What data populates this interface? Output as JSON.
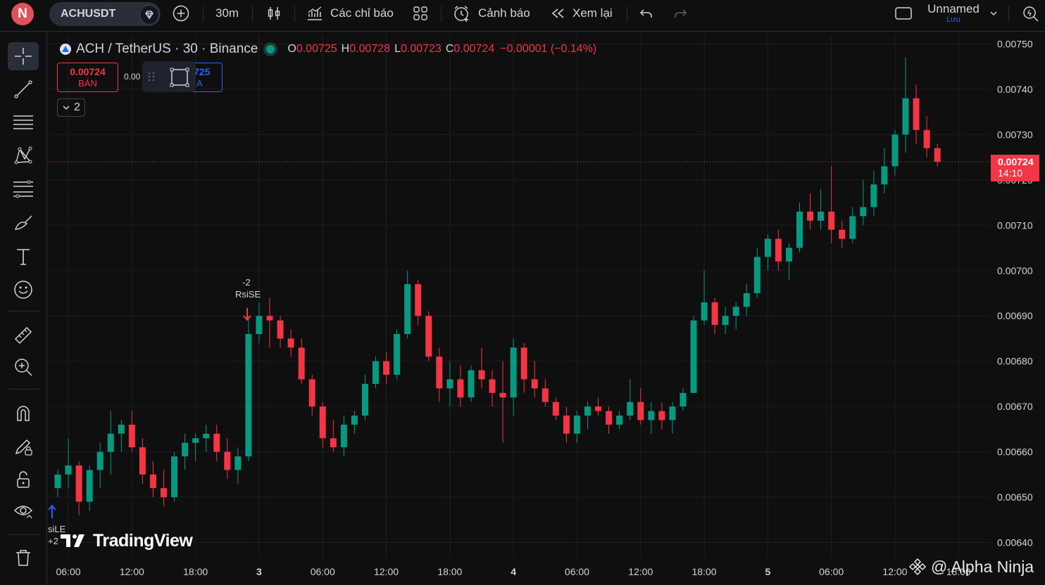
{
  "header": {
    "avatar_letter": "N",
    "symbol": "ACHUSDT",
    "interval": "30m",
    "indicators_label": "Các chỉ báo",
    "alerts_label": "Cảnh báo",
    "replay_label": "Xem lại",
    "layout_name": "Unnamed",
    "save_status": "Lưu"
  },
  "legend": {
    "title": "ACH / TetherUS · 30 · Binance",
    "o_label": "O",
    "o_value": "0.00725",
    "h_label": "H",
    "h_value": "0.00728",
    "l_label": "L",
    "l_value": "0.00723",
    "c_label": "C",
    "c_value": "0.00724",
    "change": "−0.00001 (−0.14%)"
  },
  "trade": {
    "sell_price": "0.00724",
    "sell_label": "BÁN",
    "spread": "0.00",
    "buy_price": "725",
    "buy_label": "A",
    "collapse_count": "2"
  },
  "markers": {
    "sell_count": "-2",
    "sell_name": "RsiSE",
    "buy_name": "siLE",
    "buy_count": "+2"
  },
  "branding": {
    "tradingview": "TradingView",
    "watermark": "@ Alpha Ninja"
  },
  "current_price": {
    "value": "0.00724",
    "countdown": "14:10"
  },
  "colors": {
    "up": "#089981",
    "down": "#f23645",
    "background": "#0f0f0f",
    "grid": "#1c1f26"
  },
  "chart_data": {
    "type": "candlestick",
    "title": "ACH / TetherUS · 30 · Binance",
    "y_ticks": [
      "0.00750",
      "0.00740",
      "0.00730",
      "0.00720",
      "0.00710",
      "0.00700",
      "0.00690",
      "0.00680",
      "0.00670",
      "0.00660",
      "0.00650",
      "0.00640"
    ],
    "ylim": [
      0.00639,
      0.00751
    ],
    "x_ticks": [
      "06:00",
      "12:00",
      "18:00",
      "3",
      "06:00",
      "12:00",
      "18:00",
      "4",
      "06:00",
      "12:00",
      "18:00",
      "5",
      "06:00",
      "12:00",
      "18:00"
    ],
    "x_tick_index": [
      1,
      7,
      13,
      19,
      25,
      31,
      37,
      43,
      49,
      55,
      61,
      67,
      73,
      79,
      85
    ],
    "current_price": 0.00724,
    "ohlc": [
      [
        0.00652,
        0.00656,
        0.0065,
        0.00655
      ],
      [
        0.00655,
        0.00663,
        0.00652,
        0.00657
      ],
      [
        0.00657,
        0.00658,
        0.00646,
        0.00649
      ],
      [
        0.00649,
        0.00657,
        0.00647,
        0.00656
      ],
      [
        0.00656,
        0.00662,
        0.00652,
        0.0066
      ],
      [
        0.0066,
        0.00669,
        0.00655,
        0.00664
      ],
      [
        0.00664,
        0.00667,
        0.0066,
        0.00666
      ],
      [
        0.00666,
        0.00669,
        0.0066,
        0.00661
      ],
      [
        0.00661,
        0.00663,
        0.00653,
        0.00655
      ],
      [
        0.00655,
        0.00658,
        0.0065,
        0.00652
      ],
      [
        0.00652,
        0.00656,
        0.00648,
        0.0065
      ],
      [
        0.0065,
        0.0066,
        0.00649,
        0.00659
      ],
      [
        0.00659,
        0.00664,
        0.00656,
        0.00662
      ],
      [
        0.00662,
        0.00664,
        0.00658,
        0.00663
      ],
      [
        0.00663,
        0.00666,
        0.0066,
        0.00664
      ],
      [
        0.00664,
        0.00666,
        0.00658,
        0.0066
      ],
      [
        0.0066,
        0.00663,
        0.00654,
        0.00656
      ],
      [
        0.00656,
        0.00661,
        0.00653,
        0.00659
      ],
      [
        0.00659,
        0.0069,
        0.00658,
        0.00686
      ],
      [
        0.00686,
        0.00693,
        0.00684,
        0.0069
      ],
      [
        0.0069,
        0.00694,
        0.00683,
        0.00689
      ],
      [
        0.00689,
        0.0069,
        0.00683,
        0.00685
      ],
      [
        0.00685,
        0.00687,
        0.00681,
        0.00683
      ],
      [
        0.00683,
        0.00685,
        0.00675,
        0.00676
      ],
      [
        0.00676,
        0.00677,
        0.00668,
        0.0067
      ],
      [
        0.0067,
        0.00671,
        0.00661,
        0.00663
      ],
      [
        0.00663,
        0.00667,
        0.0066,
        0.00661
      ],
      [
        0.00661,
        0.00668,
        0.00659,
        0.00666
      ],
      [
        0.00666,
        0.00669,
        0.00664,
        0.00668
      ],
      [
        0.00668,
        0.00677,
        0.00667,
        0.00675
      ],
      [
        0.00675,
        0.00681,
        0.00674,
        0.0068
      ],
      [
        0.0068,
        0.00682,
        0.00675,
        0.00677
      ],
      [
        0.00677,
        0.00687,
        0.00676,
        0.00686
      ],
      [
        0.00686,
        0.007,
        0.00685,
        0.00697
      ],
      [
        0.00697,
        0.00698,
        0.00688,
        0.0069
      ],
      [
        0.0069,
        0.00691,
        0.0068,
        0.00681
      ],
      [
        0.00681,
        0.00683,
        0.00671,
        0.00674
      ],
      [
        0.00674,
        0.0068,
        0.0067,
        0.00676
      ],
      [
        0.00676,
        0.00679,
        0.0067,
        0.00672
      ],
      [
        0.00672,
        0.00679,
        0.00671,
        0.00678
      ],
      [
        0.00678,
        0.00683,
        0.00674,
        0.00676
      ],
      [
        0.00676,
        0.00678,
        0.0067,
        0.00673
      ],
      [
        0.00673,
        0.0068,
        0.00662,
        0.00672
      ],
      [
        0.00672,
        0.00685,
        0.00668,
        0.00683
      ],
      [
        0.00683,
        0.00684,
        0.00673,
        0.00676
      ],
      [
        0.00676,
        0.0068,
        0.00672,
        0.00674
      ],
      [
        0.00674,
        0.00676,
        0.0067,
        0.00671
      ],
      [
        0.00671,
        0.00672,
        0.00667,
        0.00668
      ],
      [
        0.00668,
        0.0067,
        0.00662,
        0.00664
      ],
      [
        0.00664,
        0.00669,
        0.00662,
        0.00668
      ],
      [
        0.00668,
        0.00671,
        0.00665,
        0.0067
      ],
      [
        0.0067,
        0.00672,
        0.00668,
        0.00669
      ],
      [
        0.00669,
        0.0067,
        0.00664,
        0.00666
      ],
      [
        0.00666,
        0.00669,
        0.00665,
        0.00668
      ],
      [
        0.00668,
        0.00676,
        0.00667,
        0.00671
      ],
      [
        0.00671,
        0.00674,
        0.00666,
        0.00667
      ],
      [
        0.00667,
        0.00671,
        0.00664,
        0.00669
      ],
      [
        0.00669,
        0.00671,
        0.00665,
        0.00667
      ],
      [
        0.00667,
        0.00671,
        0.00664,
        0.0067
      ],
      [
        0.0067,
        0.00674,
        0.00669,
        0.00673
      ],
      [
        0.00673,
        0.0069,
        0.00673,
        0.00689
      ],
      [
        0.00689,
        0.007,
        0.00688,
        0.00693
      ],
      [
        0.00693,
        0.00694,
        0.00686,
        0.00688
      ],
      [
        0.00688,
        0.00692,
        0.00686,
        0.0069
      ],
      [
        0.0069,
        0.00693,
        0.00687,
        0.00692
      ],
      [
        0.00692,
        0.00697,
        0.0069,
        0.00695
      ],
      [
        0.00695,
        0.00705,
        0.00694,
        0.00703
      ],
      [
        0.00703,
        0.00708,
        0.007,
        0.00707
      ],
      [
        0.00707,
        0.00709,
        0.007,
        0.00702
      ],
      [
        0.00702,
        0.00706,
        0.00698,
        0.00705
      ],
      [
        0.00705,
        0.00715,
        0.00704,
        0.00713
      ],
      [
        0.00713,
        0.00717,
        0.00709,
        0.00711
      ],
      [
        0.00711,
        0.00718,
        0.00709,
        0.00713
      ],
      [
        0.00713,
        0.00723,
        0.00706,
        0.00709
      ],
      [
        0.00709,
        0.00711,
        0.00705,
        0.00707
      ],
      [
        0.00707,
        0.00714,
        0.00706,
        0.00712
      ],
      [
        0.00712,
        0.0072,
        0.0071,
        0.00714
      ],
      [
        0.00714,
        0.00722,
        0.00712,
        0.00719
      ],
      [
        0.00719,
        0.00727,
        0.00717,
        0.00723
      ],
      [
        0.00723,
        0.00731,
        0.00721,
        0.0073
      ],
      [
        0.0073,
        0.00747,
        0.00726,
        0.00738
      ],
      [
        0.00738,
        0.00741,
        0.00728,
        0.00731
      ],
      [
        0.00731,
        0.00734,
        0.00725,
        0.00727
      ],
      [
        0.00727,
        0.00728,
        0.00723,
        0.00724
      ]
    ]
  }
}
